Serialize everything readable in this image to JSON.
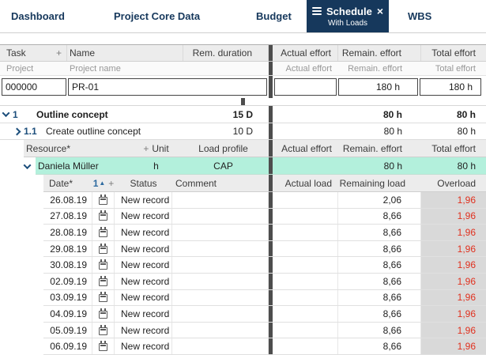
{
  "colors": {
    "accent_navy": "#16385c",
    "highlight_teal": "#b3f0dc",
    "overload_red": "#e0301e",
    "header_gray": "#ececec",
    "overload_bg_gray": "#d9d9d9"
  },
  "tabs": [
    {
      "label": "Dashboard"
    },
    {
      "label": "Project Core Data"
    },
    {
      "label": "Budget"
    },
    {
      "label": "Schedule",
      "subtitle": "With Loads",
      "active": true
    },
    {
      "label": "WBS"
    }
  ],
  "icons": {
    "close": "×",
    "plus": "+",
    "sort_number": "1",
    "sort_triangle": "▲"
  },
  "columns": {
    "task": "Task",
    "name": "Name",
    "rem_duration": "Rem. duration",
    "actual_effort": "Actual effort",
    "remain_effort": "Remain. effort",
    "total_effort": "Total effort"
  },
  "project_header": {
    "project": "Project",
    "project_name": "Project name",
    "actual_effort": "Actual effort",
    "remain_effort": "Remain. effort",
    "total_effort": "Total effort"
  },
  "project_row": {
    "id": "000000",
    "name": "PR-01",
    "actual_effort": "",
    "remain_effort": "180 h",
    "total_effort": "180 h"
  },
  "tasks": [
    {
      "wbs": "1",
      "name": "Outline concept",
      "rem_duration": "15 D",
      "actual_effort": "",
      "remain_effort": "80 h",
      "total_effort": "80 h"
    },
    {
      "wbs": "1.1",
      "name": "Create outline concept",
      "rem_duration": "10 D",
      "actual_effort": "",
      "remain_effort": "80 h",
      "total_effort": "80 h"
    }
  ],
  "resource_header": {
    "resource": "Resource*",
    "unit": "Unit",
    "load_profile": "Load profile",
    "actual_effort": "Actual effort",
    "remain_effort": "Remain. effort",
    "total_effort": "Total effort"
  },
  "resource": {
    "name": "Daniela Müller",
    "unit": "h",
    "load_profile": "CAP",
    "actual_effort": "",
    "remain_effort": "80 h",
    "total_effort": "80 h"
  },
  "load_header": {
    "date": "Date*",
    "status": "Status",
    "comment": "Comment",
    "actual_load": "Actual load",
    "remaining_load": "Remaining load",
    "overload": "Overload"
  },
  "loads": [
    {
      "date": "26.08.19",
      "status": "New record",
      "comment": "",
      "actual_load": "",
      "remaining_load": "2,06",
      "overload": "1,96"
    },
    {
      "date": "27.08.19",
      "status": "New record",
      "comment": "",
      "actual_load": "",
      "remaining_load": "8,66",
      "overload": "1,96"
    },
    {
      "date": "28.08.19",
      "status": "New record",
      "comment": "",
      "actual_load": "",
      "remaining_load": "8,66",
      "overload": "1,96"
    },
    {
      "date": "29.08.19",
      "status": "New record",
      "comment": "",
      "actual_load": "",
      "remaining_load": "8,66",
      "overload": "1,96"
    },
    {
      "date": "30.08.19",
      "status": "New record",
      "comment": "",
      "actual_load": "",
      "remaining_load": "8,66",
      "overload": "1,96"
    },
    {
      "date": "02.09.19",
      "status": "New record",
      "comment": "",
      "actual_load": "",
      "remaining_load": "8,66",
      "overload": "1,96"
    },
    {
      "date": "03.09.19",
      "status": "New record",
      "comment": "",
      "actual_load": "",
      "remaining_load": "8,66",
      "overload": "1,96"
    },
    {
      "date": "04.09.19",
      "status": "New record",
      "comment": "",
      "actual_load": "",
      "remaining_load": "8,66",
      "overload": "1,96"
    },
    {
      "date": "05.09.19",
      "status": "New record",
      "comment": "",
      "actual_load": "",
      "remaining_load": "8,66",
      "overload": "1,96"
    },
    {
      "date": "06.09.19",
      "status": "New record",
      "comment": "",
      "actual_load": "",
      "remaining_load": "8,66",
      "overload": "1,96"
    }
  ]
}
